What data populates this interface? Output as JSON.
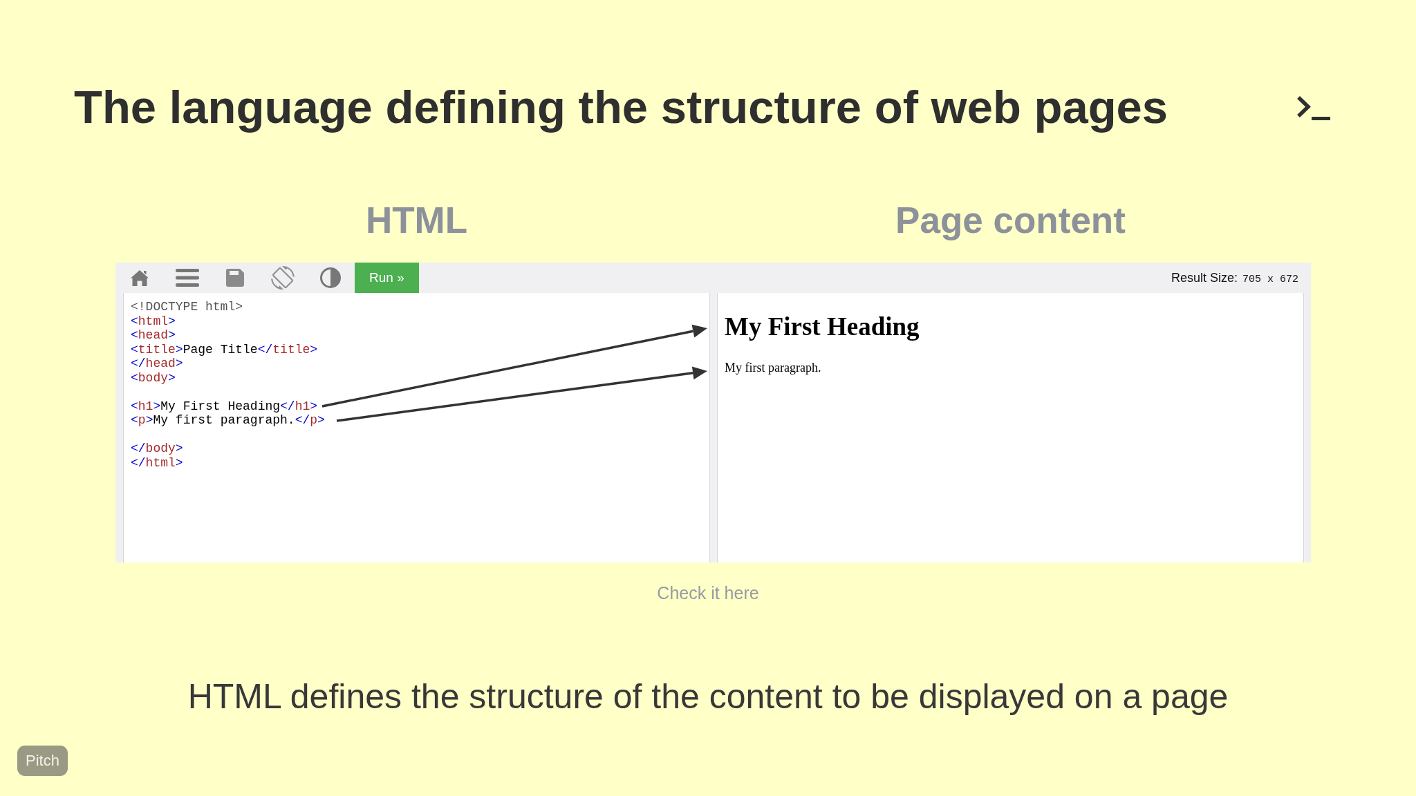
{
  "slide": {
    "title": "The language defining the structure of web pages",
    "link": "Check it here",
    "caption": "HTML defines the structure of the content to be displayed on a page",
    "badge": "Pitch"
  },
  "columns": [
    {
      "heading": "HTML"
    },
    {
      "heading": "Page content"
    }
  ],
  "editor": {
    "toolbar": {
      "tools": [
        {
          "kind": "home"
        },
        {
          "kind": "menu"
        },
        {
          "kind": "save"
        },
        {
          "kind": "rotate"
        },
        {
          "kind": "contrast"
        }
      ],
      "run_button": "Run »",
      "result_size_label": "Result Size:",
      "result_size_value": "705 x 672"
    },
    "code_lines": [
      {
        "kind": "code",
        "tokens": [
          {
            "kind": "meta",
            "text": "<!DOCTYPE html>"
          }
        ]
      },
      {
        "kind": "code",
        "tokens": [
          {
            "kind": "punct",
            "text": "<"
          },
          {
            "kind": "tag",
            "text": "html"
          },
          {
            "kind": "punct",
            "text": ">"
          }
        ]
      },
      {
        "kind": "code",
        "tokens": [
          {
            "kind": "punct",
            "text": "<"
          },
          {
            "kind": "tag",
            "text": "head"
          },
          {
            "kind": "punct",
            "text": ">"
          }
        ]
      },
      {
        "kind": "code",
        "tokens": [
          {
            "kind": "punct",
            "text": "<"
          },
          {
            "kind": "tag",
            "text": "title"
          },
          {
            "kind": "punct",
            "text": ">"
          },
          {
            "kind": "text",
            "text": "Page Title"
          },
          {
            "kind": "punct",
            "text": "</"
          },
          {
            "kind": "tag",
            "text": "title"
          },
          {
            "kind": "punct",
            "text": ">"
          }
        ]
      },
      {
        "kind": "code",
        "tokens": [
          {
            "kind": "punct",
            "text": "</"
          },
          {
            "kind": "tag",
            "text": "head"
          },
          {
            "kind": "punct",
            "text": ">"
          }
        ]
      },
      {
        "kind": "code",
        "tokens": [
          {
            "kind": "punct",
            "text": "<"
          },
          {
            "kind": "tag",
            "text": "body"
          },
          {
            "kind": "punct",
            "text": ">"
          }
        ]
      },
      {
        "kind": "blank"
      },
      {
        "kind": "code",
        "tokens": [
          {
            "kind": "punct",
            "text": "<"
          },
          {
            "kind": "tag",
            "text": "h1"
          },
          {
            "kind": "punct",
            "text": ">"
          },
          {
            "kind": "text",
            "text": "My First Heading"
          },
          {
            "kind": "punct",
            "text": "</"
          },
          {
            "kind": "tag",
            "text": "h1"
          },
          {
            "kind": "punct",
            "text": ">"
          }
        ]
      },
      {
        "kind": "code",
        "tokens": [
          {
            "kind": "punct",
            "text": "<"
          },
          {
            "kind": "tag",
            "text": "p"
          },
          {
            "kind": "punct",
            "text": ">"
          },
          {
            "kind": "text",
            "text": "My first paragraph."
          },
          {
            "kind": "punct",
            "text": "</"
          },
          {
            "kind": "tag",
            "text": "p"
          },
          {
            "kind": "punct",
            "text": ">"
          }
        ]
      },
      {
        "kind": "blank"
      },
      {
        "kind": "code",
        "tokens": [
          {
            "kind": "punct",
            "text": "</"
          },
          {
            "kind": "tag",
            "text": "body"
          },
          {
            "kind": "punct",
            "text": ">"
          }
        ]
      },
      {
        "kind": "code",
        "tokens": [
          {
            "kind": "punct",
            "text": "</"
          },
          {
            "kind": "tag",
            "text": "html"
          },
          {
            "kind": "punct",
            "text": ">"
          }
        ]
      }
    ]
  },
  "result": {
    "heading": "My First Heading",
    "paragraph": "My first paragraph."
  }
}
